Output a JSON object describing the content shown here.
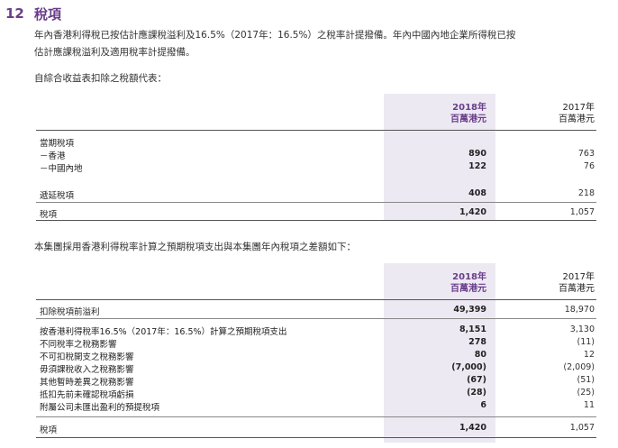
{
  "section": {
    "number": "12",
    "title": "稅項"
  },
  "intro": {
    "line1": "年內香港利得稅已按估計應課稅溢利及16.5%（2017年：16.5%）之稅率計提撥備。年內中國內地企業所得稅已按",
    "line2": "估計應課稅溢利及適用稅率計提撥備。"
  },
  "table1": {
    "caption": "自綜合收益表扣除之稅額代表：",
    "header": {
      "cur_year": "2018年",
      "cur_unit": "百萬港元",
      "prev_year": "2017年",
      "prev_unit": "百萬港元"
    },
    "rows": [
      {
        "label": "當期稅項",
        "v2018": "",
        "v2017": ""
      },
      {
        "label": "－香港",
        "v2018": "890",
        "v2017": "763"
      },
      {
        "label": "－中國內地",
        "v2018": "122",
        "v2017": "76"
      },
      {
        "label": "遞延稅項",
        "v2018": "408",
        "v2017": "218"
      },
      {
        "label": "稅項",
        "v2018": "1,420",
        "v2017": "1,057"
      }
    ]
  },
  "table2": {
    "caption": "本集團採用香港利得稅率計算之預期稅項支出與本集團年內稅項之差額如下：",
    "header": {
      "cur_year": "2018年",
      "cur_unit": "百萬港元",
      "prev_year": "2017年",
      "prev_unit": "百萬港元"
    },
    "rows": [
      {
        "label": "扣除稅項前溢利",
        "v2018": "49,399",
        "v2017": "18,970"
      },
      {
        "label": "按香港利得稅率16.5%（2017年：16.5%）計算之預期稅項支出",
        "v2018": "8,151",
        "v2017": "3,130"
      },
      {
        "label": "不同稅率之稅務影響",
        "v2018": "278",
        "v2017": "(11)"
      },
      {
        "label": "不可扣稅開支之稅務影響",
        "v2018": "80",
        "v2017": "12"
      },
      {
        "label": "毋須課稅收入之稅務影響",
        "v2018": "(7,000)",
        "v2017": "(2,009)"
      },
      {
        "label": "其他暫時差異之稅務影響",
        "v2018": "(67)",
        "v2017": "(51)"
      },
      {
        "label": "抵扣先前未確認稅項虧損",
        "v2018": "(28)",
        "v2017": "(25)"
      },
      {
        "label": "附屬公司未匯出盈利的預提稅項",
        "v2018": "6",
        "v2017": "11"
      },
      {
        "label": "稅項",
        "v2018": "1,420",
        "v2017": "1,057"
      }
    ]
  },
  "colors": {
    "accent": "#6a3d8a",
    "shade": "#ece9f3"
  }
}
